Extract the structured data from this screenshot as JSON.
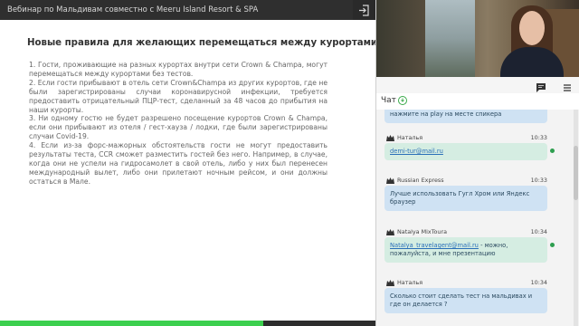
{
  "window": {
    "title": "Вебинар по Мальдивам совместно с Meeru Island Resort & SPA"
  },
  "slide": {
    "title": "Новые правила для желающих перемещаться между курортами",
    "paragraphs": [
      "1. Гости, проживающие на разных курортах внутри сети Crown & Champa, могут перемещаться между курортами без тестов.",
      "2. Если гости прибывают в отель сети Crown&Champa из других курортов, где не были зарегистрированы случаи коронавирусной инфекции, требуется предоставить отрицательный ПЦР-тест, сделанный за 48 часов до прибытия на наши курорты.",
      "3. Ни одному гостю не будет разрешено посещение курортов Crown & Champa, если они прибывают из отеля / гест-хауза / лодки, где были зарегистрированы случаи Covid-19.",
      "4. Если из-за форс-мажорных обстоятельств гости не могут предоставить результаты теста, ССR сможет разместить гостей без него. Например, в случае, когда они не успели на гидросамолет в свой отель, либо у них был перенесен международный вылет, либо они прилетают ночным рейсом, и они должны остаться в Мале."
    ]
  },
  "progress": {
    "value": 0.7
  },
  "chat": {
    "title": "Чат",
    "messages": [
      {
        "author": "",
        "time": "",
        "text": "нажмите на play на месте спикера",
        "style": "blue"
      },
      {
        "author": "Наталья",
        "time": "10:33",
        "text": "demi-tur@mail.ru",
        "style": "green",
        "is_link": true
      },
      {
        "author": "Russian Express",
        "time": "10:33",
        "text": "Лучше использовать Гугл Хром или Яндекс браузер",
        "style": "blue"
      },
      {
        "author": "Natalya MixToura",
        "time": "10:34",
        "link": "Natalya_travelagent@mail.ru",
        "text": " - можно, пожалуйста, и мне презентацию",
        "style": "green"
      },
      {
        "author": "Наталья",
        "time": "10:34",
        "text": "Сколько стоит сделать тест на мальдивах и где он делается ?",
        "style": "blue"
      }
    ]
  },
  "colors": {
    "accent": "#3ccf4e",
    "topbar": "#2f2f2f",
    "bubble_green": "#d5ede2",
    "bubble_blue": "#cfe2f3"
  },
  "icons": [
    "exit-icon",
    "chat-toggle-icon",
    "menu-icon",
    "help-icon",
    "user-icon",
    "crown-icon"
  ]
}
